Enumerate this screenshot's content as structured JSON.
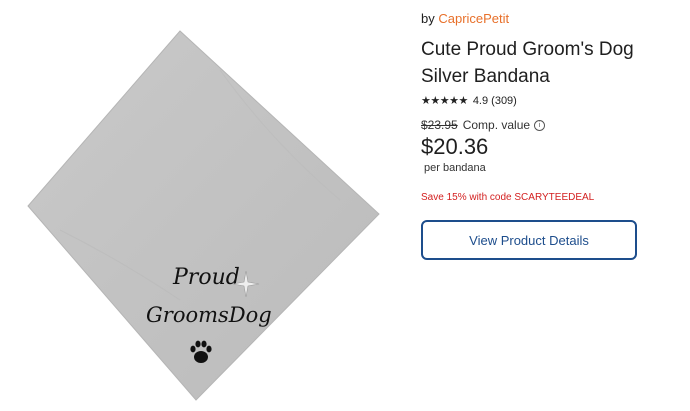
{
  "product": {
    "by_prefix": "by ",
    "seller": "CapricePetit",
    "title": "Cute Proud Groom's Dog Silver Bandana",
    "stars": "★★★★★",
    "rating": "4.9 (309)",
    "original_price": "$23.95",
    "comp_label": "Comp. value",
    "info_icon_glyph": "i",
    "price": "$20.36",
    "unit": "per bandana",
    "promo": "Save 15% with code SCARYTEEDEAL",
    "cta_label": "View Product Details"
  },
  "image": {
    "line1": "Proud",
    "line2": "GroomsDog",
    "icon": "paw-print-icon",
    "bandana_color": "#c4c4c4"
  },
  "colors": {
    "seller_link": "#e8702a",
    "promo": "#d31f1f",
    "cta": "#1d4d8c"
  }
}
